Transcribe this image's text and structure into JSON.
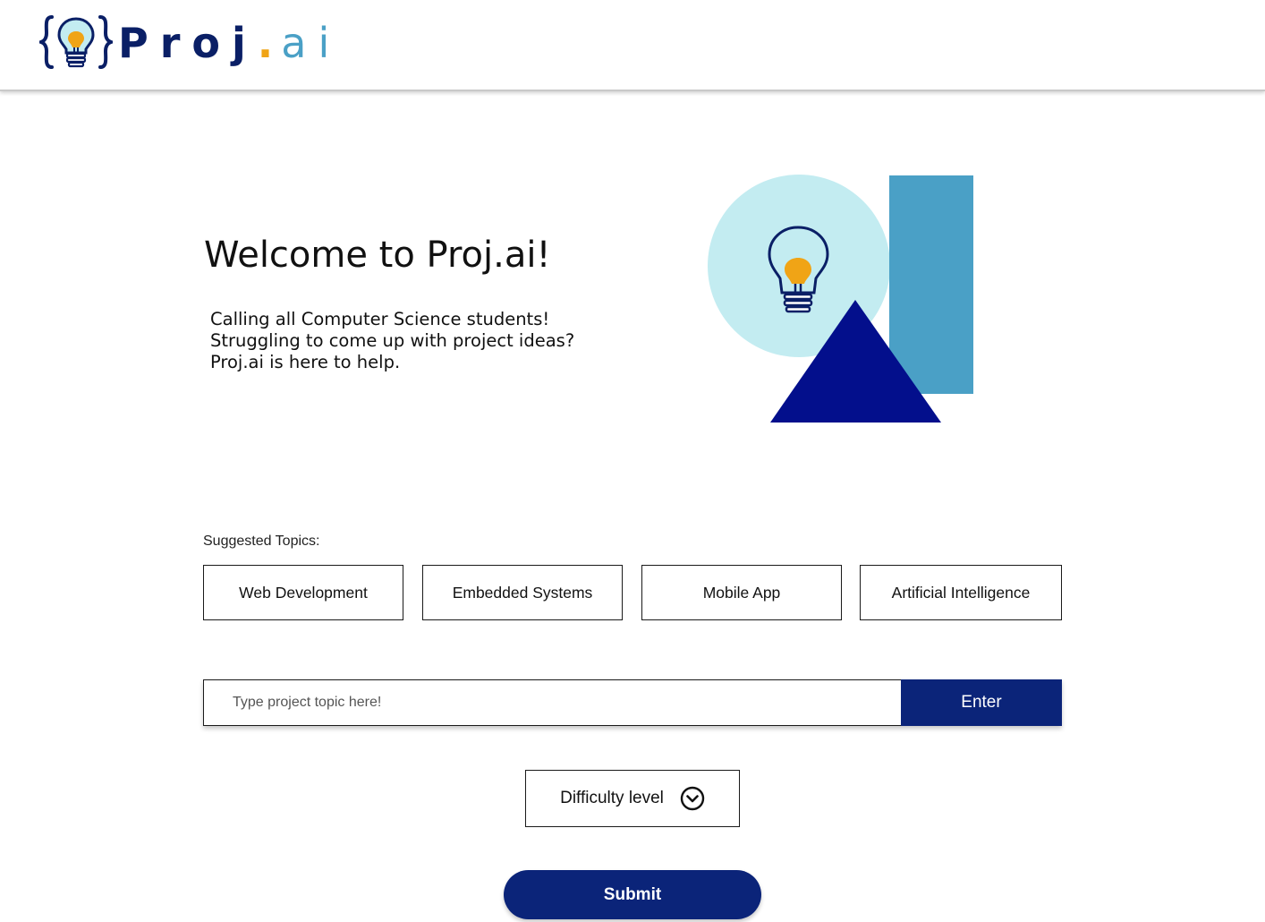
{
  "header": {
    "logo": {
      "brand": "Proj",
      "dot": ".",
      "suffix": "ai",
      "icon": "lightbulb-braces-icon"
    }
  },
  "hero": {
    "title": "Welcome to Proj.ai!",
    "intro_lines": [
      "Calling all Computer Science students!",
      "Struggling to come up with project ideas?",
      "Proj.ai is here to help."
    ],
    "illustration": {
      "icon": "lightbulb-icon",
      "colors": {
        "circle": "#c3ecf1",
        "rectangle": "#4aa0c6",
        "triangle": "#030f8c",
        "bulb_fill": "#f0a416",
        "bulb_outline": "#0a1f66"
      }
    }
  },
  "topics": {
    "label": "Suggested Topics:",
    "items": [
      {
        "label": "Web Development"
      },
      {
        "label": "Embedded Systems"
      },
      {
        "label": "Mobile App"
      },
      {
        "label": "Artificial Intelligence"
      }
    ]
  },
  "search": {
    "placeholder": "Type project topic here!",
    "value": "",
    "button_label": "Enter"
  },
  "difficulty": {
    "label": "Difficulty level",
    "icon": "chevron-down-circle-icon"
  },
  "submit": {
    "label": "Submit"
  },
  "colors": {
    "primary": "#0b2479",
    "accent": "#4aa0c6",
    "highlight": "#f0a416"
  }
}
